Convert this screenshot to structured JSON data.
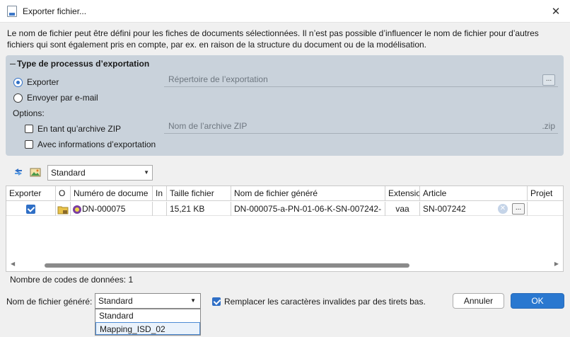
{
  "window": {
    "title": "Exporter fichier...",
    "close_glyph": "✕"
  },
  "intro_text": "Le nom de fichier peut être défini pour les fiches de documents sélectionnées. Il n’est pas possible d’influencer le nom de fichier pour d’autres fichiers qui sont également pris en compte, par ex. en raison de la structure du document ou de la modélisation.",
  "process_group": {
    "legend": "Type de processus d’exportation",
    "radio_export": "Exporter",
    "radio_email": "Envoyer par e-mail",
    "export_directory_placeholder": "Répertoire de l’exportation",
    "browse_label": "...",
    "options_label": "Options:",
    "zip_checkbox": "En tant qu’archive ZIP",
    "info_checkbox": "Avec informations d’exportation",
    "zip_name_placeholder": "Nom de l’archive ZIP",
    "zip_suffix": ".zip"
  },
  "toolbar": {
    "view_combo": "Standard"
  },
  "grid": {
    "columns": [
      "Exporter",
      "O",
      "Numéro de docume",
      "In",
      "Taille fichier",
      "Nom de fichier généré",
      "Extensio",
      "Article",
      "Projet"
    ],
    "row": {
      "document_number": "DN-000075",
      "size": "15,21 KB",
      "generated_name": "DN-000075-a-PN-01-06-K-SN-007242-",
      "extension": "vaa",
      "article": "SN-007242",
      "article_button": "..."
    }
  },
  "data_count": "Nombre de codes de données: 1",
  "bottom": {
    "generated_name_label": "Nom de fichier généré:",
    "generated_name_value": "Standard",
    "dropdown_options": [
      "Standard",
      "Mapping_ISD_02"
    ],
    "replace_checkbox": "Remplacer les caractères invalides par des tirets bas.",
    "cancel_label": "Annuler",
    "ok_label": "OK"
  },
  "colors": {
    "accent": "#2a78d0",
    "group_bg": "#c9d2db"
  }
}
